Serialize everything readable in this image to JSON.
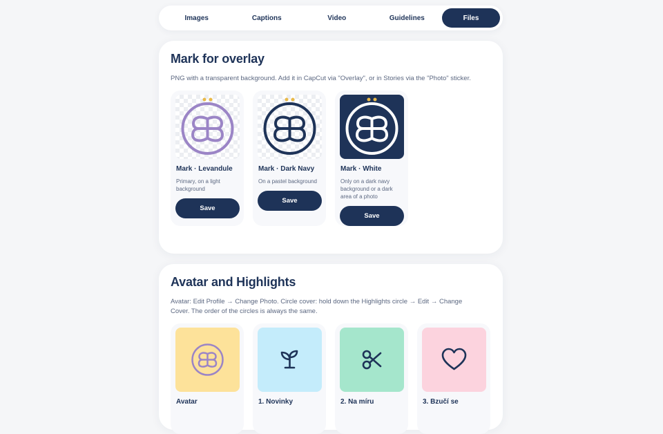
{
  "tabs": [
    "Images",
    "Captions",
    "Video",
    "Guidelines",
    "Files"
  ],
  "active_tab": "Files",
  "overlay": {
    "title": "Mark for overlay",
    "description": "PNG with a transparent background. Add it in CapCut via \"Overlay\", or in Stories via the \"Photo\" sticker.",
    "items": [
      {
        "title": "Mark · Levandule",
        "desc": "Primary, on a light background",
        "button": "Save",
        "color": "#9b85c6",
        "bg": "checker"
      },
      {
        "title": "Mark · Dark Navy",
        "desc": "On a pastel background",
        "button": "Save",
        "color": "#1e3358",
        "bg": "checker"
      },
      {
        "title": "Mark · White",
        "desc": "Only on a dark navy background or a dark area of a photo",
        "button": "Save",
        "color": "#ffffff",
        "bg": "#1e3358"
      }
    ]
  },
  "highlights": {
    "title": "Avatar and Highlights",
    "description": "Avatar: Edit Profile → Change Photo. Circle cover: hold down the Highlights circle → Edit → Change Cover. The order of the circles is always the same.",
    "items": [
      {
        "title": "Avatar",
        "icon": "mark-icon",
        "bg": "#fde29a"
      },
      {
        "title": "1. Novinky",
        "icon": "sprout-icon",
        "bg": "#c4ecfb"
      },
      {
        "title": "2. Na míru",
        "icon": "scissors-icon",
        "bg": "#a5e6cc"
      },
      {
        "title": "3. Bzučí se",
        "icon": "heart-icon",
        "bg": "#fcd3de"
      }
    ]
  },
  "colors": {
    "navy": "#1e3358",
    "lavender": "#9b85c6",
    "gold": "#e9b949"
  }
}
